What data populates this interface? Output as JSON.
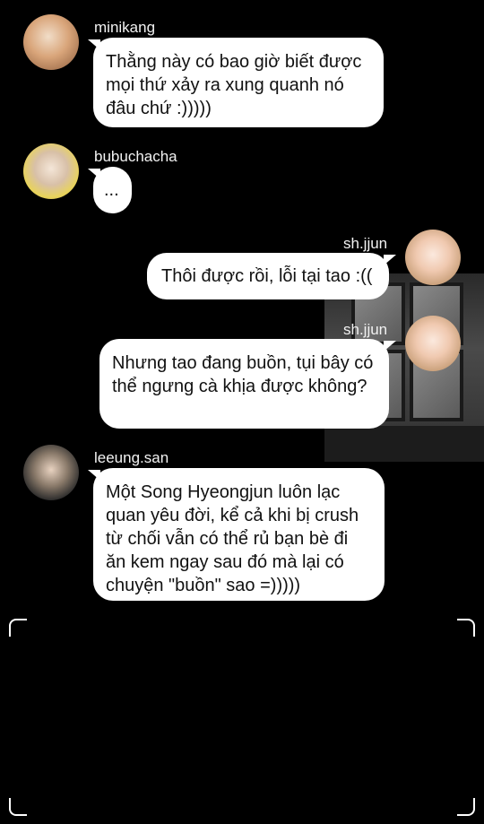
{
  "messages": [
    {
      "username": "minikang",
      "text": " Thằng này có bao giờ biết được mọi thứ xảy ra xung quanh nó đâu chứ :)))))"
    },
    {
      "username": "bubuchacha",
      "text": "..."
    },
    {
      "username": "sh.jjun",
      "text": "Thôi được rồi, lỗi tại tao :(("
    },
    {
      "username": "sh.jjun",
      "text": " Nhưng tao đang buồn, tụi bây có thể ngưng cà khịa được không?"
    },
    {
      "username": "leeung.san",
      "text": " Một Song Hyeongjun luôn lạc quan yêu đời, kể cả khi bị crush từ chối vẫn có thể rủ bạn bè đi ăn kem ngay sau đó mà lại có chuyện \"buồn\" sao =)))))"
    }
  ]
}
